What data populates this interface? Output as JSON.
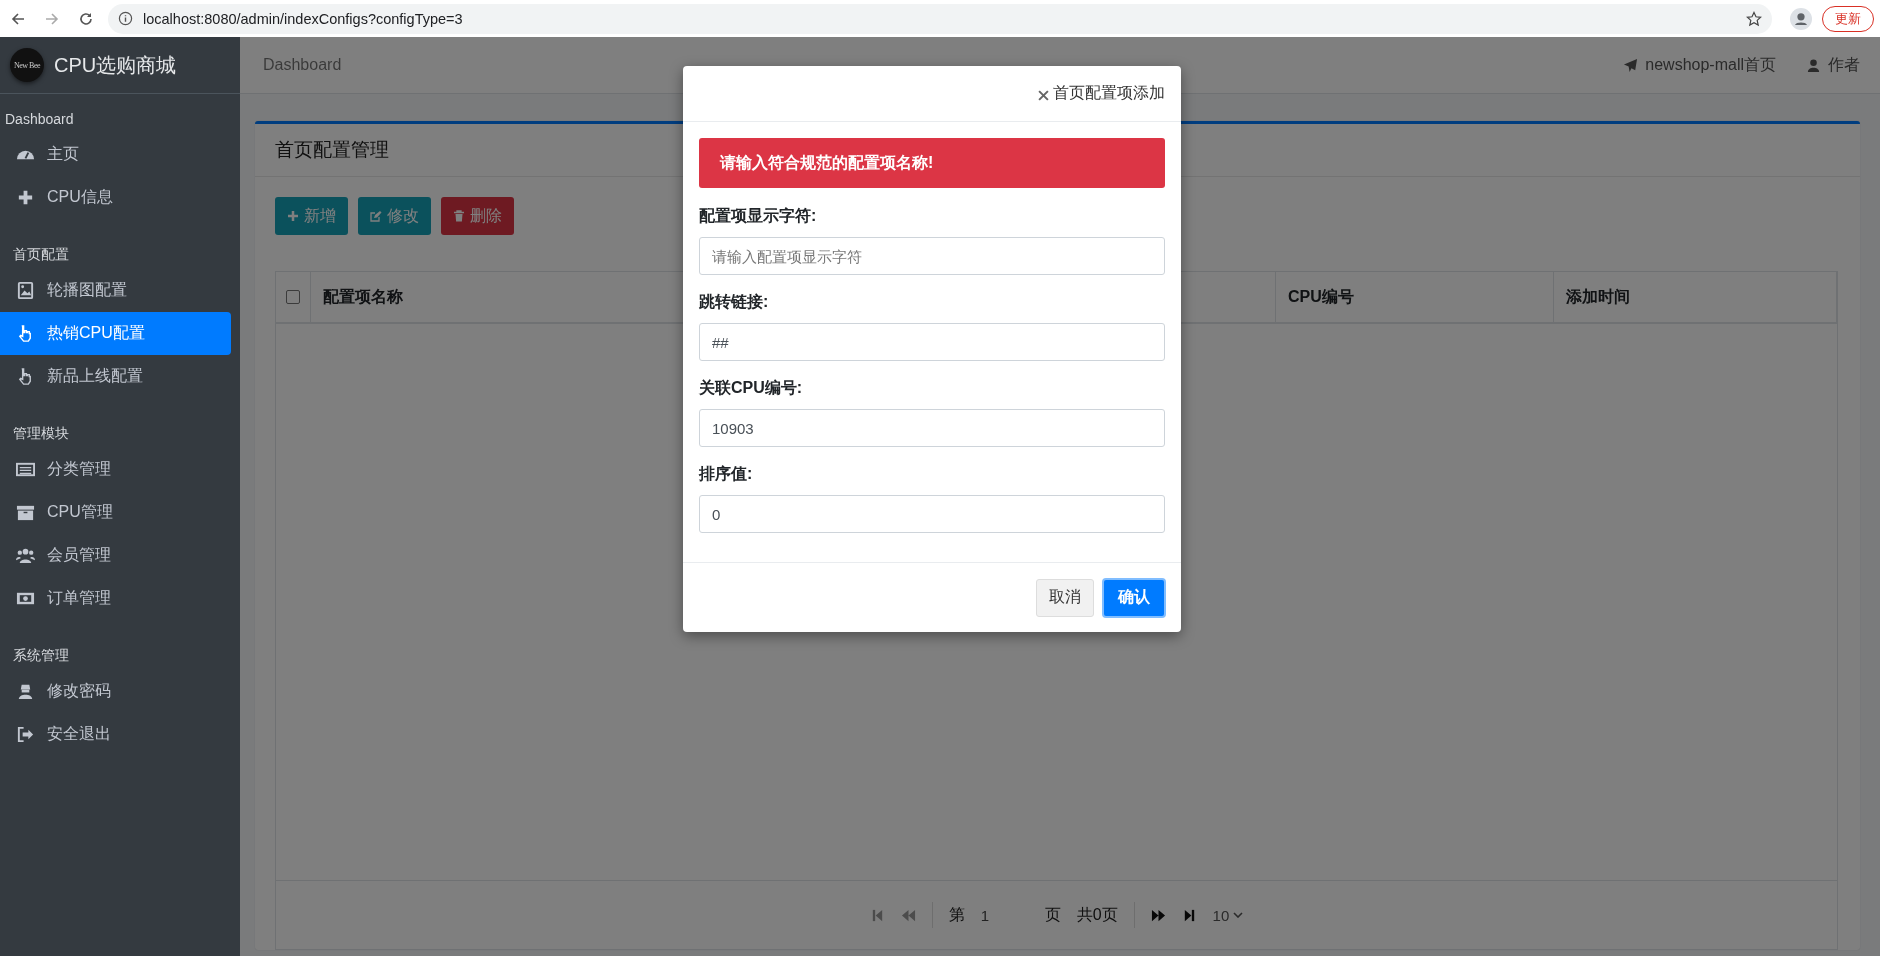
{
  "browser": {
    "url": "localhost:8080/admin/indexConfigs?configType=3",
    "update_button": "更新"
  },
  "sidebar": {
    "logo_text": "New Bee",
    "brand": "CPU选购商城",
    "sections": [
      {
        "heading": "Dashboard",
        "items": [
          {
            "label": "主页",
            "selected": false
          },
          {
            "label": "CPU信息",
            "selected": false
          }
        ]
      },
      {
        "heading": "首页配置",
        "items": [
          {
            "label": "轮播图配置",
            "selected": false
          },
          {
            "label": "热销CPU配置",
            "selected": true
          },
          {
            "label": "新品上线配置",
            "selected": false
          }
        ]
      },
      {
        "heading": "管理模块",
        "items": [
          {
            "label": "分类管理",
            "selected": false
          },
          {
            "label": "CPU管理",
            "selected": false
          },
          {
            "label": "会员管理",
            "selected": false
          },
          {
            "label": "订单管理",
            "selected": false
          }
        ]
      },
      {
        "heading": "系统管理",
        "items": [
          {
            "label": "修改密码",
            "selected": false
          },
          {
            "label": "安全退出",
            "selected": false
          }
        ]
      }
    ]
  },
  "navbar": {
    "breadcrumb": "Dashboard",
    "links": [
      {
        "label": "newshop-mall首页",
        "kind": "home"
      },
      {
        "label": "作者",
        "kind": "author"
      }
    ]
  },
  "card": {
    "title": "首页配置管理",
    "buttons": [
      {
        "label": "新增",
        "kind": "add"
      },
      {
        "label": "修改",
        "kind": "edit"
      },
      {
        "label": "删除",
        "kind": "delete"
      }
    ],
    "table": {
      "select_all_checked": false,
      "columns": [
        "配置项名称",
        "CPU编号",
        "添加时间"
      ]
    },
    "pagination": {
      "controls": [
        {
          "kind": "first",
          "disabled": true
        },
        {
          "kind": "prev",
          "disabled": true
        },
        {
          "kind": "next",
          "disabled": false
        },
        {
          "kind": "last",
          "disabled": false
        }
      ],
      "page_prefix": "第",
      "page_value": "1",
      "page_suffix": "页",
      "total": "共0页",
      "page_size": "10"
    }
  },
  "modal": {
    "title": "首页配置项添加",
    "alert": "请输入符合规范的配置项名称!",
    "fields": [
      {
        "label": "配置项显示字符:",
        "placeholder": "请输入配置项显示字符"
      },
      {
        "label": "跳转链接:",
        "value": "##"
      },
      {
        "label": "关联CPU编号:",
        "value": "10903"
      },
      {
        "label": "排序值:",
        "value": "0"
      }
    ],
    "cancel": "取消",
    "confirm": "确认"
  }
}
